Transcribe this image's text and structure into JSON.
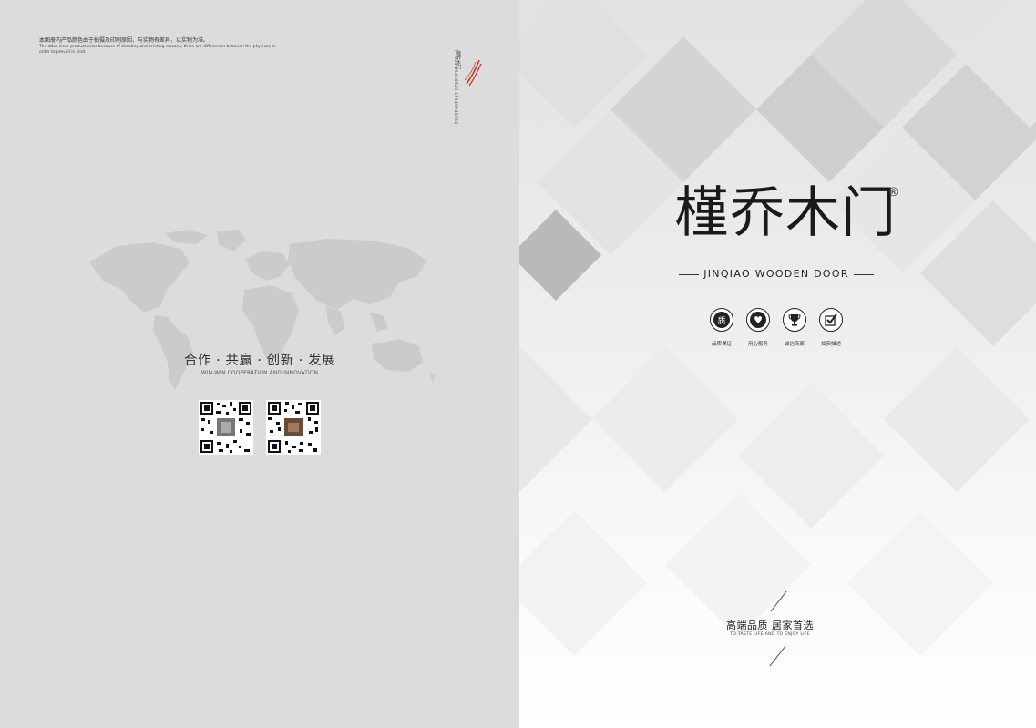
{
  "left_page": {
    "disclaimer_cn": "本图册内产品颜色由于拍摄及印刷原因，与实物有差异，以实物为准。",
    "disclaimer_en": "The atlas inner product color because of shooting and printing reasons, there are differences between the physical, in order to prevail in kind.",
    "vertical_contact": "T：024-25468829  15940946056",
    "mini_logo_text": "槿乔木门",
    "slogan_cn": "合作 · 共赢 · 创新 · 发展",
    "slogan_en": "WIN-WIN COOPERATION AND INNOVATION",
    "qr_codes": [
      {
        "name": "qr-code-1",
        "image": "qr-code-icon"
      },
      {
        "name": "qr-code-2",
        "image": "qr-code-icon"
      }
    ]
  },
  "right_page": {
    "brand_cn": "槿乔木门",
    "registered_mark": "®",
    "brand_en": "JINQIAO WOODEN DOOR",
    "features": [
      {
        "label": "品质保证",
        "icon": "quality-seal-icon",
        "glyph": "质"
      },
      {
        "label": "用心服务",
        "icon": "heart-icon",
        "glyph": "♥"
      },
      {
        "label": "诚信商家",
        "icon": "trophy-icon",
        "glyph": "🏆"
      },
      {
        "label": "如实描述",
        "icon": "checkmark-icon",
        "glyph": "✔"
      }
    ],
    "tagline_cn": "高端品质  居家首选",
    "tagline_en": "TO TASTE LIFE AND TO ENJOY LIFE"
  },
  "colors": {
    "left_background": "#dcdcdc",
    "text_dark": "#1a1a1a",
    "accent_red": "#c8322d"
  }
}
